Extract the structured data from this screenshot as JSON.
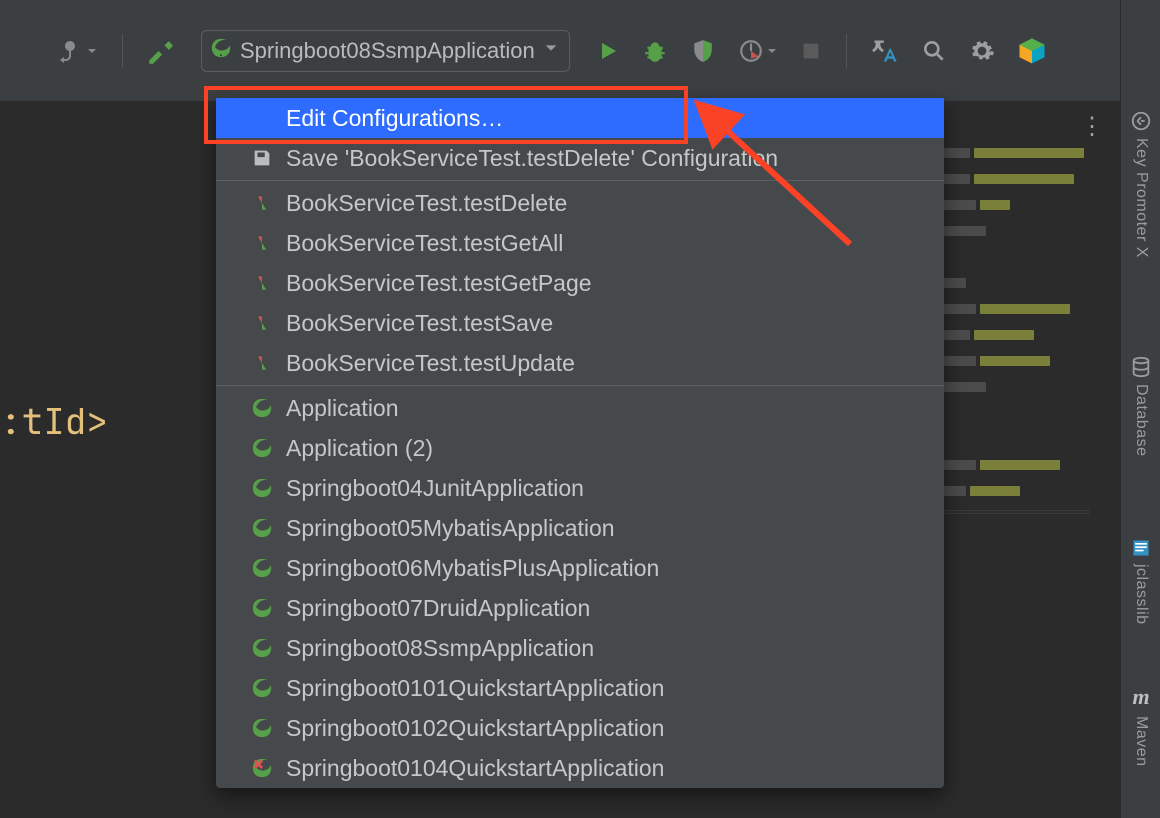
{
  "toolbar": {
    "run_config_label": "Springboot08SsmpApplication"
  },
  "dropdown": {
    "edit_config": "Edit Configurations…",
    "save_config": "Save 'BookServiceTest.testDelete' Configuration",
    "tests": [
      "BookServiceTest.testDelete",
      "BookServiceTest.testGetAll",
      "BookServiceTest.testGetPage",
      "BookServiceTest.testSave",
      "BookServiceTest.testUpdate"
    ],
    "apps": [
      "Application",
      "Application (2)",
      "Springboot04JunitApplication",
      "Springboot05MybatisApplication",
      "Springboot06MybatisPlusApplication",
      "Springboot07DruidApplication",
      "Springboot08SsmpApplication",
      "Springboot0101QuickstartApplication",
      "Springboot0102QuickstartApplication"
    ],
    "app_error": "Springboot0104QuickstartApplication"
  },
  "rightbar": {
    "key_promoter": "Key Promoter X",
    "database": "Database",
    "jclasslib": "jclasslib",
    "maven": "Maven"
  },
  "editor": {
    "code_fragment": ":tId>"
  },
  "colors": {
    "accent": "#2e6bff",
    "annotation": "#fa4226",
    "bg_dark": "#2b2b2b",
    "bg_panel": "#3c3f41"
  }
}
